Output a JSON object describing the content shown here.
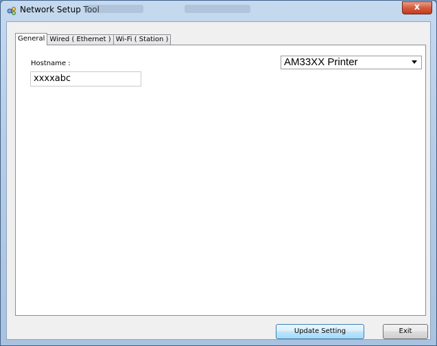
{
  "window": {
    "title": "Network Setup Tool",
    "close_label": "x"
  },
  "tabs": [
    {
      "label": "General",
      "active": true
    },
    {
      "label": "Wired ( Ethernet )",
      "active": false
    },
    {
      "label": "Wi-Fi ( Station )",
      "active": false
    }
  ],
  "general": {
    "hostname_label": "Hostname :",
    "hostname_value": "xxxxabc",
    "printer_model": "AM33XX Printer"
  },
  "footer": {
    "update_label": "Update Setting",
    "exit_label": "Exit"
  },
  "icons": {
    "app": "network-setup-icon",
    "close": "close-icon",
    "dropdown": "chevron-down-icon"
  }
}
